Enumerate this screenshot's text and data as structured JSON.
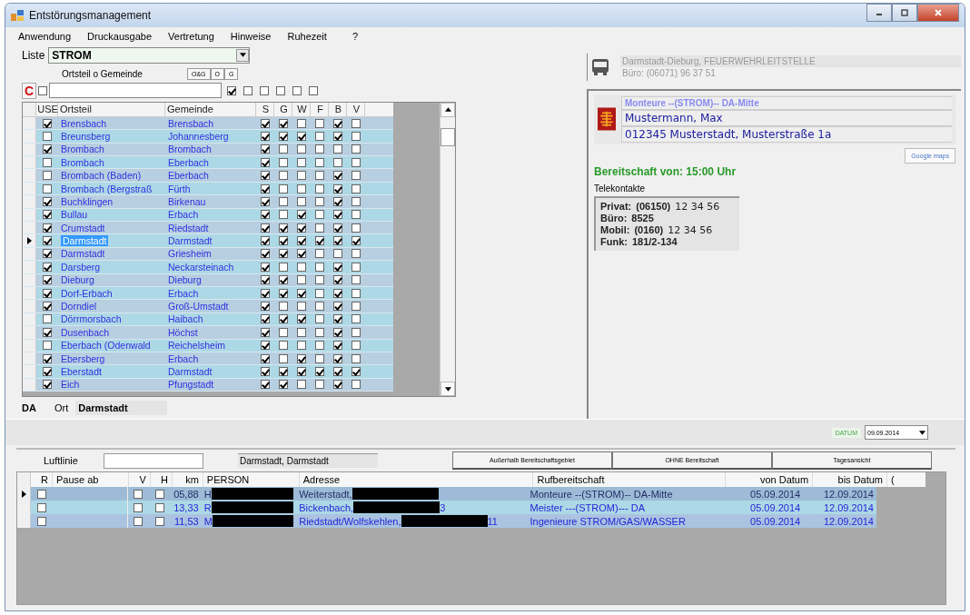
{
  "window": {
    "title": "Entstörungsmanagement"
  },
  "menu": [
    "Anwendung",
    "Druckausgabe",
    "Vertretung",
    "Hinweise",
    "Ruhezeit",
    "?"
  ],
  "liste": {
    "label": "Liste",
    "value": "STROM"
  },
  "filter": {
    "label": "Ortsteil o Gemeinde",
    "mode_buttons": [
      "O&G",
      "O",
      "G"
    ],
    "clear_button": "C",
    "use_checked": false,
    "flags": [
      true,
      false,
      false,
      false,
      false,
      false
    ]
  },
  "grid": {
    "columns": [
      "USE",
      "Ortsteil",
      "Gemeinde",
      "S",
      "G",
      "W",
      "F",
      "B",
      "V"
    ],
    "rows": [
      {
        "use": true,
        "ortsteil": "Brensbach",
        "gemeinde": "Brensbach",
        "flags": [
          true,
          true,
          false,
          false,
          true,
          false
        ],
        "selected": false
      },
      {
        "use": false,
        "ortsteil": "Breunsberg",
        "gemeinde": "Johannesberg",
        "flags": [
          true,
          true,
          true,
          false,
          true,
          false
        ],
        "selected": false
      },
      {
        "use": true,
        "ortsteil": "Brombach",
        "gemeinde": "Brombach",
        "flags": [
          true,
          false,
          false,
          false,
          false,
          false
        ],
        "selected": false
      },
      {
        "use": false,
        "ortsteil": "Brombach",
        "gemeinde": "Eberbach",
        "flags": [
          true,
          false,
          false,
          false,
          false,
          false
        ],
        "selected": false
      },
      {
        "use": false,
        "ortsteil": "Brombach (Baden)",
        "gemeinde": "Eberbach",
        "flags": [
          true,
          false,
          false,
          false,
          true,
          false
        ],
        "selected": false
      },
      {
        "use": false,
        "ortsteil": "Brombach (Bergstraß",
        "gemeinde": "Fürth",
        "flags": [
          true,
          false,
          false,
          false,
          true,
          false
        ],
        "selected": false
      },
      {
        "use": true,
        "ortsteil": "Buchklingen",
        "gemeinde": "Birkenau",
        "flags": [
          true,
          false,
          false,
          false,
          true,
          false
        ],
        "selected": false
      },
      {
        "use": true,
        "ortsteil": "Bullau",
        "gemeinde": "Erbach",
        "flags": [
          true,
          false,
          true,
          false,
          true,
          false
        ],
        "selected": false
      },
      {
        "use": true,
        "ortsteil": "Crumstadt",
        "gemeinde": "Riedstadt",
        "flags": [
          true,
          true,
          true,
          false,
          true,
          false
        ],
        "selected": false
      },
      {
        "use": true,
        "ortsteil": "Darmstadt",
        "gemeinde": "Darmstadt",
        "flags": [
          true,
          true,
          true,
          true,
          true,
          true
        ],
        "selected": true
      },
      {
        "use": true,
        "ortsteil": "Darmstadt",
        "gemeinde": "Griesheim",
        "flags": [
          true,
          true,
          true,
          false,
          false,
          false
        ],
        "selected": false
      },
      {
        "use": true,
        "ortsteil": "Darsberg",
        "gemeinde": "Neckarsteinach",
        "flags": [
          true,
          false,
          false,
          false,
          true,
          false
        ],
        "selected": false
      },
      {
        "use": true,
        "ortsteil": "Dieburg",
        "gemeinde": "Dieburg",
        "flags": [
          true,
          true,
          false,
          false,
          true,
          false
        ],
        "selected": false
      },
      {
        "use": true,
        "ortsteil": "Dorf-Erbach",
        "gemeinde": "Erbach",
        "flags": [
          true,
          true,
          true,
          false,
          true,
          false
        ],
        "selected": false
      },
      {
        "use": true,
        "ortsteil": "Dorndiel",
        "gemeinde": "Groß-Umstadt",
        "flags": [
          true,
          false,
          false,
          false,
          true,
          false
        ],
        "selected": false
      },
      {
        "use": false,
        "ortsteil": "Dörrmorsbach",
        "gemeinde": "Haibach",
        "flags": [
          true,
          true,
          true,
          false,
          true,
          false
        ],
        "selected": false
      },
      {
        "use": true,
        "ortsteil": "Dusenbach",
        "gemeinde": "Höchst",
        "flags": [
          true,
          false,
          false,
          false,
          true,
          false
        ],
        "selected": false
      },
      {
        "use": false,
        "ortsteil": "Eberbach (Odenwald",
        "gemeinde": "Reichelsheim",
        "flags": [
          true,
          false,
          false,
          false,
          true,
          false
        ],
        "selected": false
      },
      {
        "use": true,
        "ortsteil": "Ebersberg",
        "gemeinde": "Erbach",
        "flags": [
          true,
          false,
          true,
          false,
          true,
          false
        ],
        "selected": false
      },
      {
        "use": true,
        "ortsteil": "Eberstadt",
        "gemeinde": "Darmstadt",
        "flags": [
          true,
          true,
          true,
          true,
          true,
          true
        ],
        "selected": false
      },
      {
        "use": true,
        "ortsteil": "Eich",
        "gemeinde": "Pfungstadt",
        "flags": [
          true,
          true,
          false,
          false,
          true,
          false
        ],
        "selected": false
      }
    ]
  },
  "ort_bar": {
    "code": "DA",
    "label": "Ort",
    "value": "Darmstadt"
  },
  "leitstelle": {
    "name": "Darmstadt-Dieburg, FEUERWEHRLEITSTELLE",
    "phone": "Büro:  (06071) 96 37 51"
  },
  "contact": {
    "group": "Monteure --(STROM)--  DA-Mitte",
    "name": "Mustermann, Max",
    "address": "012345 Musterstadt, Musterstraße 1a",
    "maps_button": "Google maps",
    "bereitschaft": "Bereitschaft von: 15:00 Uhr",
    "telekontakte_label": "Telekontakte",
    "telekontakte": [
      {
        "label": "Privat:",
        "value": "(06150)",
        "extra": "12 34 56"
      },
      {
        "label": "Büro:",
        "value": "8525"
      },
      {
        "label": "Mobil:",
        "value": "(0160)",
        "extra": "12 34 56"
      },
      {
        "label": "Funk:",
        "value": "181/2-134"
      }
    ]
  },
  "datum": {
    "label": "DATUM",
    "value": "09.09.2014"
  },
  "bottom": {
    "luftlinie_label": "Luftlinie",
    "location": "Darmstadt, Darmstadt",
    "buttons": [
      "Außerhalb Bereitschaftsgebiet",
      "OHNE Bereitschaft",
      "Tagesansicht"
    ],
    "columns": [
      "R",
      "Pause ab",
      "V",
      "H",
      "km",
      "PERSON",
      "Adresse",
      "Rufbereitschaft",
      "von Datum",
      "bis Datum",
      "("
    ],
    "rows": [
      {
        "r": false,
        "v": false,
        "h": false,
        "km": "05,88",
        "person": "H",
        "adresse": "Weiterstadt,",
        "rufbereitschaft": "Monteure --(STROM)--  DA-Mitte",
        "von": "05.09.2014",
        "bis": "12.09.2014",
        "selected": true
      },
      {
        "r": false,
        "v": false,
        "h": false,
        "km": "13,33",
        "person": "R",
        "adresse": "Bickenbach,",
        "adresse_tail": "3",
        "rufbereitschaft": "Meister ---(STROM)---  DA",
        "von": "05.09.2014",
        "bis": "12.09.2014",
        "selected": false
      },
      {
        "r": false,
        "v": false,
        "h": false,
        "km": "11,53",
        "person": "M",
        "adresse": "Riedstadt/Wolfskehlen,",
        "adresse_tail": "11",
        "rufbereitschaft": "Ingenieure STROM/GAS/WASSER",
        "von": "05.09.2014",
        "bis": "12.09.2014",
        "selected": false
      }
    ]
  }
}
